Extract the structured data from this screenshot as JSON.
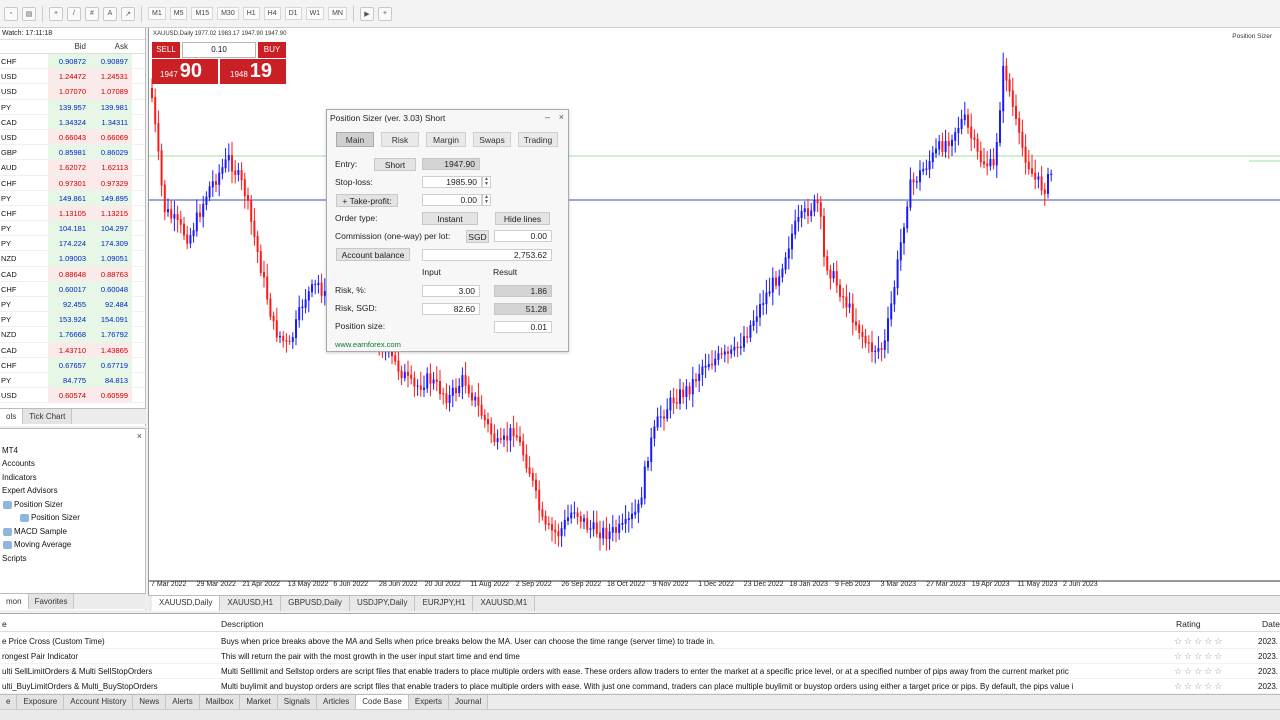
{
  "market_watch": {
    "title": "Watch: 17:11:18",
    "col_bid": "Bid",
    "col_ask": "Ask",
    "rows": [
      {
        "symbol": "CHF",
        "bid": "0.90872",
        "ask": "0.90897",
        "dir": "up"
      },
      {
        "symbol": "USD",
        "bid": "1.24472",
        "ask": "1.24531",
        "dir": "down"
      },
      {
        "symbol": "USD",
        "bid": "1.07070",
        "ask": "1.07089",
        "dir": "down"
      },
      {
        "symbol": "PY",
        "bid": "139.957",
        "ask": "139.981",
        "dir": "up"
      },
      {
        "symbol": "CAD",
        "bid": "1.34324",
        "ask": "1.34311",
        "dir": "up"
      },
      {
        "symbol": "USD",
        "bid": "0.66043",
        "ask": "0.66069",
        "dir": "down"
      },
      {
        "symbol": "GBP",
        "bid": "0.85981",
        "ask": "0.86029",
        "dir": "up"
      },
      {
        "symbol": "AUD",
        "bid": "1.62072",
        "ask": "1.62113",
        "dir": "down"
      },
      {
        "symbol": "CHF",
        "bid": "0.97301",
        "ask": "0.97329",
        "dir": "down"
      },
      {
        "symbol": "PY",
        "bid": "149.861",
        "ask": "149.895",
        "dir": "up"
      },
      {
        "symbol": "CHF",
        "bid": "1.13105",
        "ask": "1.13215",
        "dir": "down"
      },
      {
        "symbol": "PY",
        "bid": "104.181",
        "ask": "104.297",
        "dir": "up"
      },
      {
        "symbol": "PY",
        "bid": "174.224",
        "ask": "174.309",
        "dir": "up"
      },
      {
        "symbol": "NZD",
        "bid": "1.09003",
        "ask": "1.09051",
        "dir": "up"
      },
      {
        "symbol": "CAD",
        "bid": "0.88648",
        "ask": "0.88763",
        "dir": "down"
      },
      {
        "symbol": "CHF",
        "bid": "0.60017",
        "ask": "0.60048",
        "dir": "up"
      },
      {
        "symbol": "PY",
        "bid": "92.455",
        "ask": "92.484",
        "dir": "up"
      },
      {
        "symbol": "PY",
        "bid": "153.924",
        "ask": "154.091",
        "dir": "up"
      },
      {
        "symbol": "NZD",
        "bid": "1.76668",
        "ask": "1.76792",
        "dir": "up"
      },
      {
        "symbol": "CAD",
        "bid": "1.43710",
        "ask": "1.43865",
        "dir": "down"
      },
      {
        "symbol": "CHF",
        "bid": "0.67657",
        "ask": "0.67719",
        "dir": "up"
      },
      {
        "symbol": "PY",
        "bid": "84.775",
        "ask": "84.813",
        "dir": "up"
      },
      {
        "symbol": "USD",
        "bid": "0.60574",
        "ask": "0.60599",
        "dir": "down"
      }
    ],
    "tabs": [
      "ols",
      "Tick Chart"
    ]
  },
  "navigator": {
    "items": [
      "MT4",
      "Accounts",
      "Indicators",
      "Expert Advisors",
      "Position Sizer",
      "Position Sizer",
      "MACD Sample",
      "Moving Average",
      "Scripts"
    ],
    "tabs": [
      "mon",
      "Favorites"
    ]
  },
  "chart": {
    "title": "XAUUSD,Daily 1977.02 1983.17 1947.90 1947.90",
    "indicator_label": "Position Sizer",
    "x_labels": [
      "7 Mar 2022",
      "29 Mar 2022",
      "21 Apr 2022",
      "13 May 2022",
      "6 Jun 2022",
      "28 Jun 2022",
      "20 Jul 2022",
      "11 Aug 2022",
      "2 Sep 2022",
      "26 Sep 2022",
      "18 Oct 2022",
      "9 Nov 2022",
      "1 Dec 2022",
      "23 Dec 2022",
      "18 Jan 2023",
      "9 Feb 2023",
      "3 Mar 2023",
      "27 Mar 2023",
      "19 Apr 2023",
      "11 May 2023",
      "2 Jun 2023"
    ],
    "colors": {
      "bull": "#1a1aff",
      "bear": "#ff1a1a",
      "line_blue": "#3a4fb0",
      "line_green": "#9be39b"
    }
  },
  "one_click": {
    "sell_label": "SELL",
    "buy_label": "BUY",
    "lots": "0.10",
    "sell_price_small": "1947",
    "sell_price_big": "90",
    "buy_price_small": "1948",
    "buy_price_big": "19"
  },
  "position_sizer": {
    "title": "Position Sizer (ver. 3.03) Short",
    "tabs": [
      "Main",
      "Risk",
      "Margin",
      "Swaps",
      "Trading"
    ],
    "entry_label": "Entry:",
    "entry_type": "Short",
    "entry_value": "1947.90",
    "sl_label": "Stop-loss:",
    "sl_value": "1985.90",
    "tp_label": "Take-profit:",
    "tp_value": "0.00",
    "order_type_label": "Order type:",
    "order_type": "Instant",
    "hide_lines": "Hide lines",
    "commission_label": "Commission (one-way) per lot:",
    "commission_currency": "SGD",
    "commission_value": "0.00",
    "account_balance_label": "Account balance",
    "account_balance_value": "2,753.62",
    "input_header": "Input",
    "result_header": "Result",
    "risk_pct_label": "Risk, %:",
    "risk_pct_input": "3.00",
    "risk_pct_result": "1.86",
    "risk_cur_label": "Risk, SGD:",
    "risk_cur_input": "82.60",
    "risk_cur_result": "51.28",
    "pos_size_label": "Position size:",
    "pos_size_value": "0.01",
    "link": "www.earnforex.com"
  },
  "symbol_tabs": [
    "XAUUSD,Daily",
    "XAUUSD,H1",
    "GBPUSD,Daily",
    "USDJPY,Daily",
    "EURJPY,H1",
    "XAUUSD,M1"
  ],
  "terminal": {
    "headers": {
      "name": "e",
      "description": "Description",
      "rating": "Rating",
      "date": "Date"
    },
    "rows": [
      {
        "name": "e Price Cross (Custom Time)",
        "description": "Buys when price breaks above the MA and Sells when price breaks below the MA. User can choose the time range (server time) to trade in.",
        "date": "2023."
      },
      {
        "name": "rongest Pair Indicator",
        "description": "This will return the pair with the most growth in the user input start time and end time",
        "date": "2023."
      },
      {
        "name": "ulti SellLimitOrders & Multi SellStopOrders",
        "description": "Multi Selllimit and Sellstop orders are script files that enable traders to place multiple orders with ease. These orders allow traders to enter the market at a specific price level, or at a specified number of pips away from the current market pric",
        "date": "2023."
      },
      {
        "name": "ulti_BuyLimitOrders & Multi_BuyStopOrders",
        "description": "Multi buylimit and buystop orders are script files that enable traders to place multiple orders with ease. With just one command, traders can place multiple buylimit or buystop orders using either a target price or pips. By default, the pips value i",
        "date": "2023."
      }
    ],
    "tabs": [
      "e",
      "Exposure",
      "Account History",
      "News",
      "Alerts",
      "Mailbox",
      "Market",
      "Signals",
      "Articles",
      "Code Base",
      "Experts",
      "Journal"
    ]
  }
}
